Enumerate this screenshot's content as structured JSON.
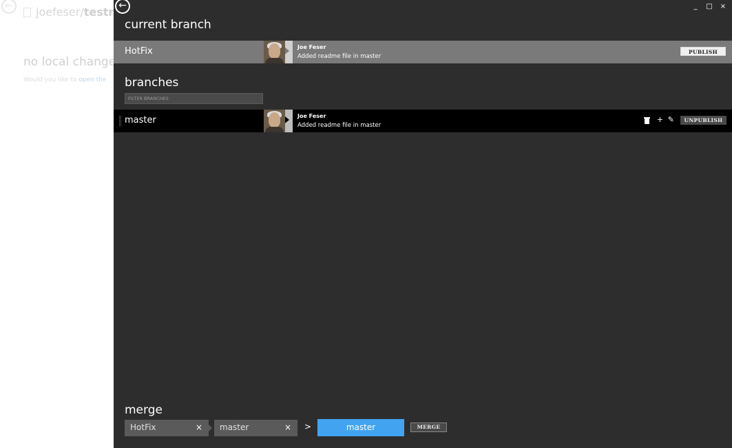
{
  "background": {
    "repo_owner": "joefeser/",
    "repo_name": "testrep",
    "no_changes": "no local changes",
    "prompt_text": "Would you like to ",
    "prompt_link": "open the"
  },
  "overlay": {
    "window_controls": [
      "_",
      "□",
      "×"
    ],
    "current_section_title": "current branch",
    "current_branch": {
      "name": "HotFix",
      "author": "Joe Feser",
      "message": "Added readme file in master",
      "action_label": "PUBLISH"
    },
    "branches_section_title": "branches",
    "filter_placeholder": "FILTER BRANCHES",
    "branches": [
      {
        "name": "master",
        "author": "Joe Feser",
        "message": "Added readme file in master",
        "action_label": "UNPUBLISH"
      }
    ],
    "merge": {
      "title": "merge",
      "source": "HotFix",
      "target_slot": "master",
      "arrow": ">",
      "destination": "master",
      "button_label": "MERGE",
      "remove_glyph": "×"
    }
  }
}
